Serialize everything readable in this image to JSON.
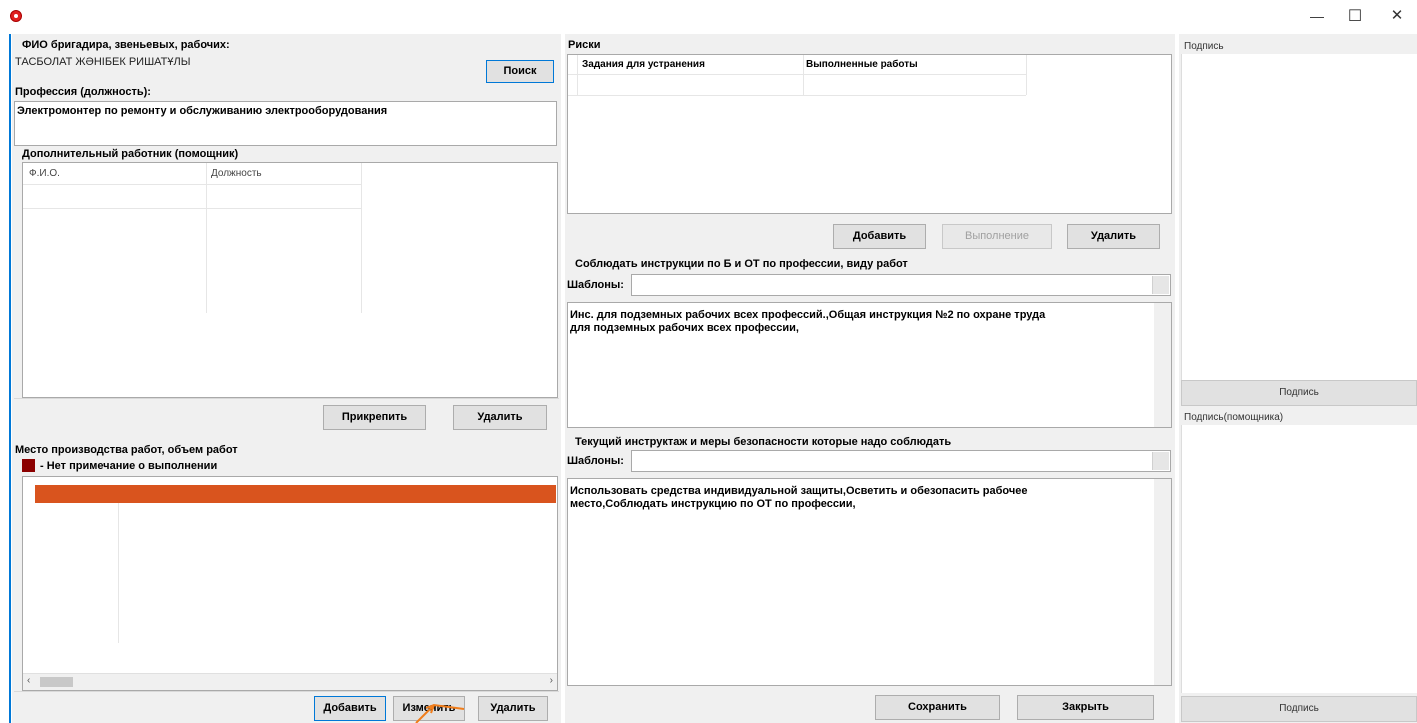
{
  "window": {
    "minimize_glyph": "—",
    "maximize_glyph": "☐",
    "close_glyph": "✕"
  },
  "left": {
    "worker_label": "ФИО бригадира, звеньевых, рабочих:",
    "worker_value": "ТАСБОЛАТ ЖӘНІБЕК РИШАТҰЛЫ",
    "search_button": "Поиск",
    "profession_label": "Профессия (должность):",
    "profession_value": "Электромонтер по ремонту и обслуживанию электрооборудования",
    "extra_label": "Дополнительный работник (помощник)",
    "extra_columns": [
      "Ф.И.О.",
      "Должность"
    ],
    "attach_button": "Прикрепить",
    "delete_button": "Удалить",
    "workplace_label": "Место производства работ, объем работ",
    "legend_text": "- Нет примечание о выполнении",
    "legend_color": "#8b0000",
    "row_color": "#d9541e",
    "add_button": "Добавить",
    "edit_button": "Изменить",
    "delete_button2": "Удалить"
  },
  "middle": {
    "risks_label": "Риски",
    "risk_columns": [
      "Задания для устранения",
      "Выполненные работы"
    ],
    "add_button": "Добавить",
    "done_button": "Выполнение",
    "delete_button": "Удалить",
    "instructions_label": "Соблюдать инструкции по Б и ОТ по профессии, виду работ",
    "templates_label": "Шаблоны:",
    "instructions_text_1": "Инс. для подземных рабочих всех профессий.,Общая инструкция №2 по охране труда",
    "instructions_text_2": "для подземных рабочих всех профессии,",
    "briefing_label": "Текущий инструктаж и меры безопасности которые надо соблюдать",
    "templates_label2": "Шаблоны:",
    "briefing_text_1": "Использовать средства индивидуальной защиты,Осветить и обезопасить рабочее",
    "briefing_text_2": "место,Соблюдать инструкцию по ОТ по профессии,",
    "save_button": "Сохранить",
    "close_button": "Закрыть"
  },
  "right": {
    "signature_label": "Подпись",
    "signature_button": "Подпись",
    "helper_signature_label": "Подпись(помощника)",
    "helper_signature_button": "Подпись"
  }
}
